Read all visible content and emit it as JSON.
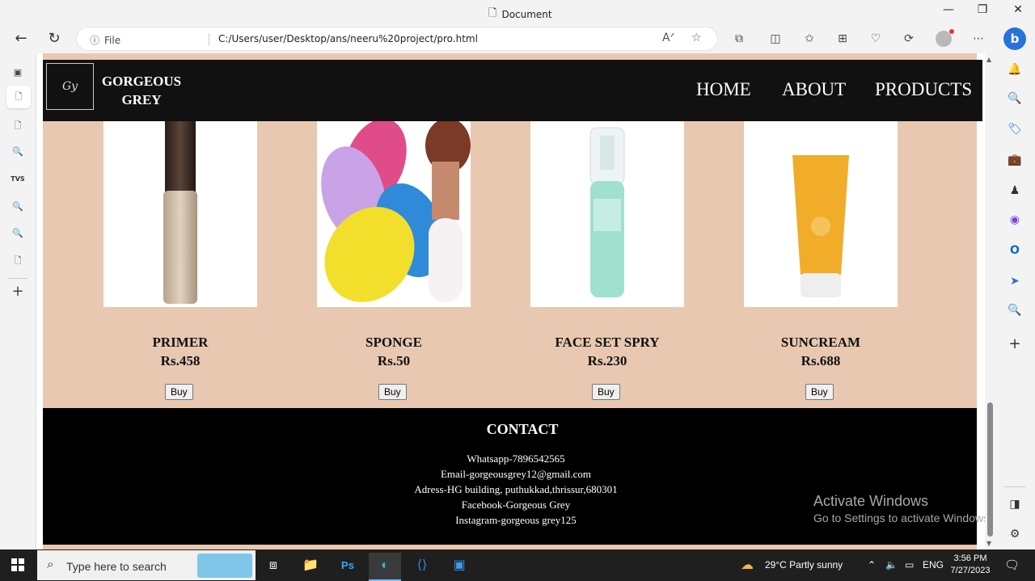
{
  "window": {
    "title": "Document",
    "minimize": "—",
    "maximize": "❐",
    "close": "✕"
  },
  "toolbar": {
    "file_label": "File",
    "url": "C:/Users/user/Desktop/ans/neeru%20project/pro.html"
  },
  "site": {
    "logo_text": "Gy",
    "brand_line1": "GORGEOUS",
    "brand_line2": "GREY",
    "nav": [
      "HOME",
      "ABOUT",
      "PRODUCTS"
    ]
  },
  "products": [
    {
      "name": "PRIMER",
      "price": "Rs.458",
      "buy": "Buy"
    },
    {
      "name": "SPONGE",
      "price": "Rs.50",
      "buy": "Buy"
    },
    {
      "name": "FACE SET SPRY",
      "price": "Rs.230",
      "buy": "Buy"
    },
    {
      "name": "SUNCREAM",
      "price": "Rs.688",
      "buy": "Buy"
    }
  ],
  "footer": {
    "heading": "CONTACT",
    "lines": [
      "Whatsapp-7896542565",
      "Email-gorgeousgrey12@gmail.com",
      "Adress-HG building, puthukkad,thrissur,680301",
      "Facebook-Gorgeous Grey",
      "Instagram-gorgeous grey125"
    ]
  },
  "watermark": {
    "line1": "Activate Windows",
    "line2": "Go to Settings to activate Windows."
  },
  "taskbar": {
    "search_placeholder": "Type here to search",
    "weather": "29°C  Partly sunny",
    "language": "ENG",
    "time": "3:56 PM",
    "date": "7/27/2023"
  },
  "colors": {
    "page_bg": "#e8c8b0",
    "navbar_bg": "#111111",
    "footer_bg": "#000000"
  }
}
